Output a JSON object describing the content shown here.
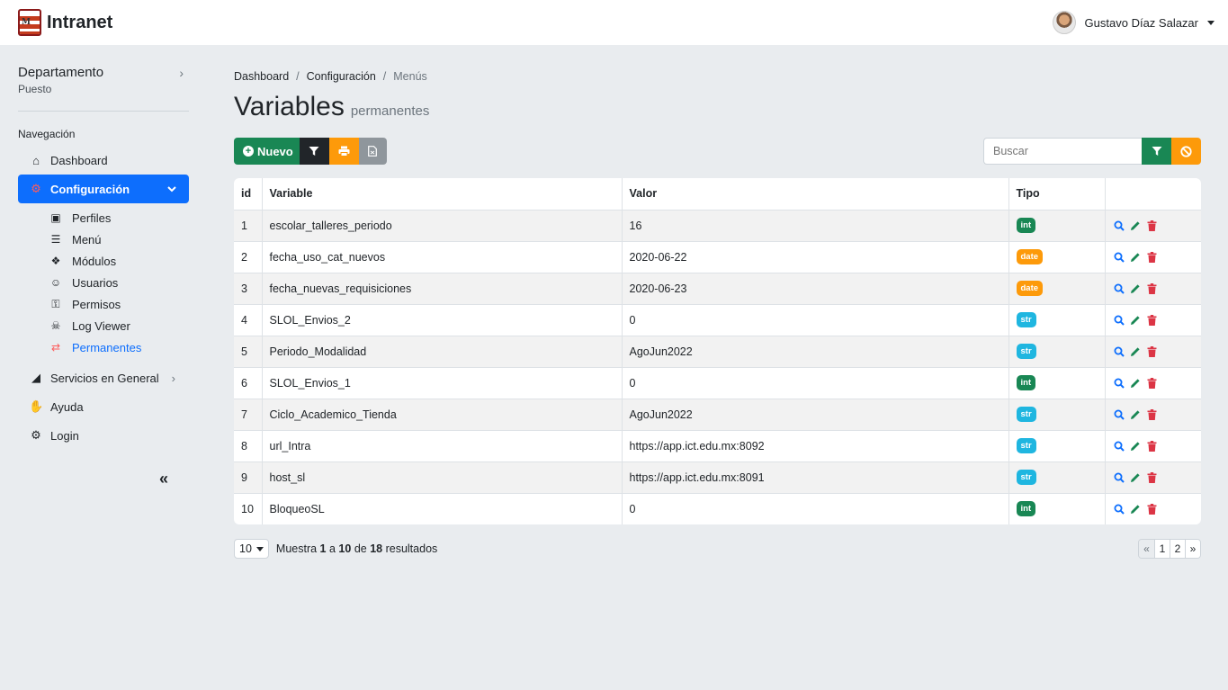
{
  "app": {
    "title": "Intranet"
  },
  "user": {
    "name": "Gustavo Díaz Salazar"
  },
  "sidebar": {
    "department": "Departamento",
    "position": "Puesto",
    "nav_heading": "Navegación",
    "items": [
      {
        "label": "Dashboard",
        "icon": "home-icon"
      },
      {
        "label": "Configuración",
        "icon": "gear-icon"
      },
      {
        "label": "Servicios en General",
        "icon": "services-icon"
      },
      {
        "label": "Ayuda",
        "icon": "handshake-icon"
      },
      {
        "label": "Login",
        "icon": "gear-icon"
      }
    ],
    "config_sub": [
      {
        "label": "Perfiles",
        "icon": "id-card-icon"
      },
      {
        "label": "Menú",
        "icon": "align-left-icon"
      },
      {
        "label": "Módulos",
        "icon": "cubes-icon"
      },
      {
        "label": "Usuarios",
        "icon": "users-icon"
      },
      {
        "label": "Permisos",
        "icon": "key-icon"
      },
      {
        "label": "Log Viewer",
        "icon": "bug-icon"
      },
      {
        "label": "Permanentes",
        "icon": "retweet-icon"
      }
    ],
    "collapse_label": "«"
  },
  "breadcrumb": [
    "Dashboard",
    "Configuración",
    "Menús"
  ],
  "page": {
    "title": "Variables",
    "subtitle": "permanentes"
  },
  "toolbar": {
    "new_label": "Nuevo"
  },
  "search": {
    "placeholder": "Buscar"
  },
  "table": {
    "headers": [
      "id",
      "Variable",
      "Valor",
      "Tipo",
      ""
    ],
    "rows": [
      {
        "id": "1",
        "variable": "escolar_talleres_periodo",
        "valor": "16",
        "tipo": "int"
      },
      {
        "id": "2",
        "variable": "fecha_uso_cat_nuevos",
        "valor": "2020-06-22",
        "tipo": "date"
      },
      {
        "id": "3",
        "variable": "fecha_nuevas_requisiciones",
        "valor": "2020-06-23",
        "tipo": "date"
      },
      {
        "id": "4",
        "variable": "SLOL_Envios_2",
        "valor": "0",
        "tipo": "str"
      },
      {
        "id": "5",
        "variable": "Periodo_Modalidad",
        "valor": "AgoJun2022",
        "tipo": "str"
      },
      {
        "id": "6",
        "variable": "SLOL_Envios_1",
        "valor": "0",
        "tipo": "int"
      },
      {
        "id": "7",
        "variable": "Ciclo_Academico_Tienda",
        "valor": "AgoJun2022",
        "tipo": "str"
      },
      {
        "id": "8",
        "variable": "url_Intra",
        "valor": "https://app.ict.edu.mx:8092",
        "tipo": "str"
      },
      {
        "id": "9",
        "variable": "host_sl",
        "valor": "https://app.ict.edu.mx:8091",
        "tipo": "str"
      },
      {
        "id": "10",
        "variable": "BloqueoSL",
        "valor": "0",
        "tipo": "int"
      }
    ]
  },
  "badge_colors": {
    "int": "#198754",
    "date": "#fd9a0a",
    "str": "#1fb6e0"
  },
  "footer": {
    "per_page": "10",
    "summary_prefix": "Muestra",
    "from": "1",
    "summary_mid1": "a",
    "to": "10",
    "summary_mid2": "de",
    "total": "18",
    "summary_suffix": "resultados",
    "pages": [
      "«",
      "1",
      "2",
      "»"
    ]
  }
}
